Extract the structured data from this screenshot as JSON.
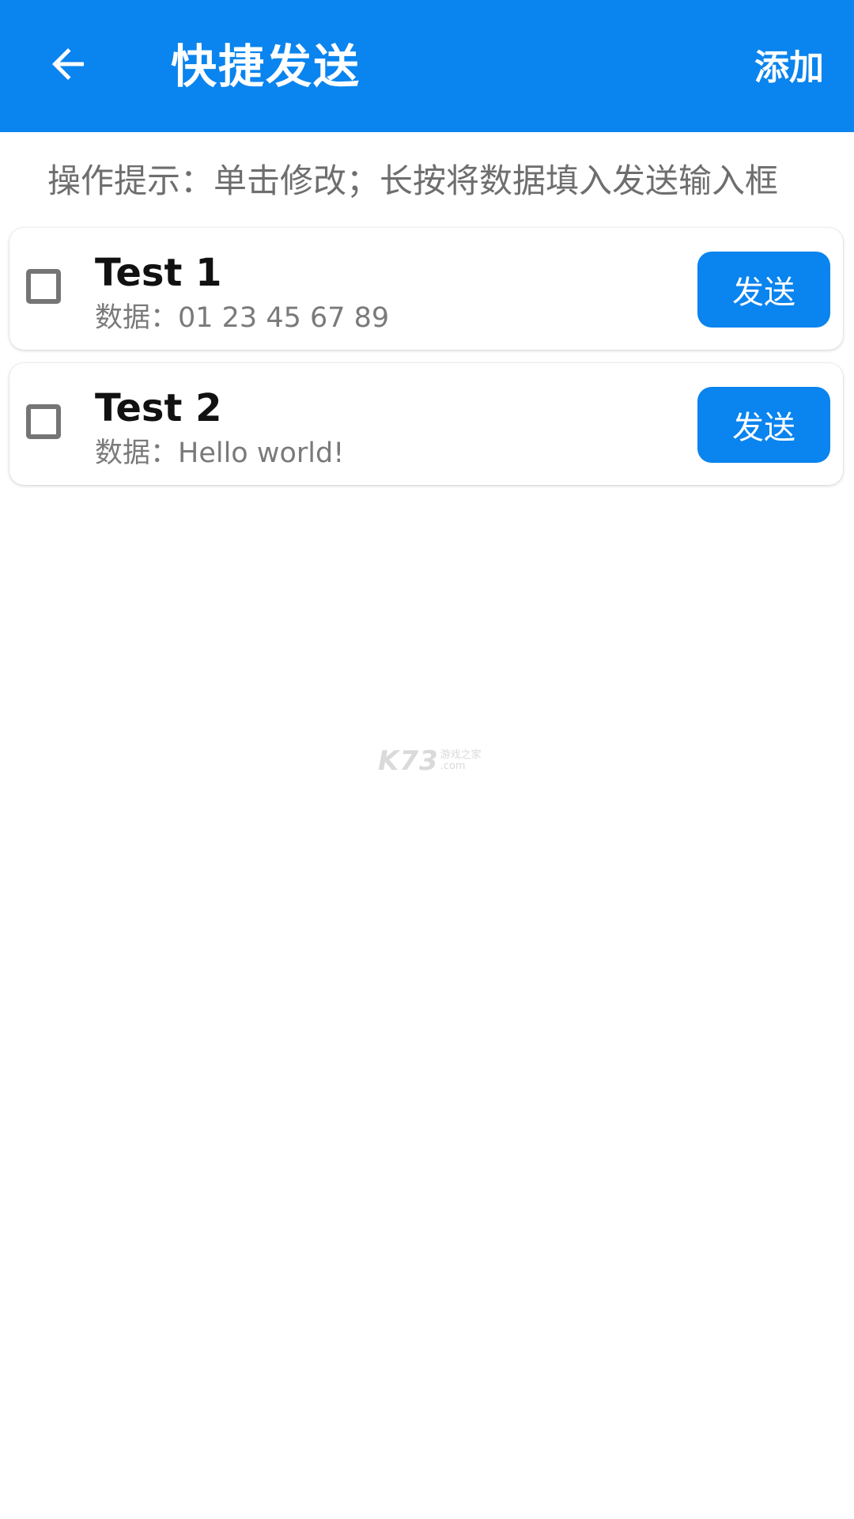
{
  "appbar": {
    "title": "快捷发送",
    "add_label": "添加",
    "back_icon": "arrow-left-icon",
    "color": "#0a84ee"
  },
  "hint": "操作提示：单击修改；长按将数据填入发送输入框",
  "items": [
    {
      "name": "Test 1",
      "data": "数据：01 23 45 67 89",
      "checked": false,
      "send_label": "发送"
    },
    {
      "name": "Test 2",
      "data": "数据：Hello world!",
      "checked": false,
      "send_label": "发送"
    }
  ],
  "watermark": {
    "main": "K73",
    "top": "游戏之家",
    "bottom": ".com"
  }
}
